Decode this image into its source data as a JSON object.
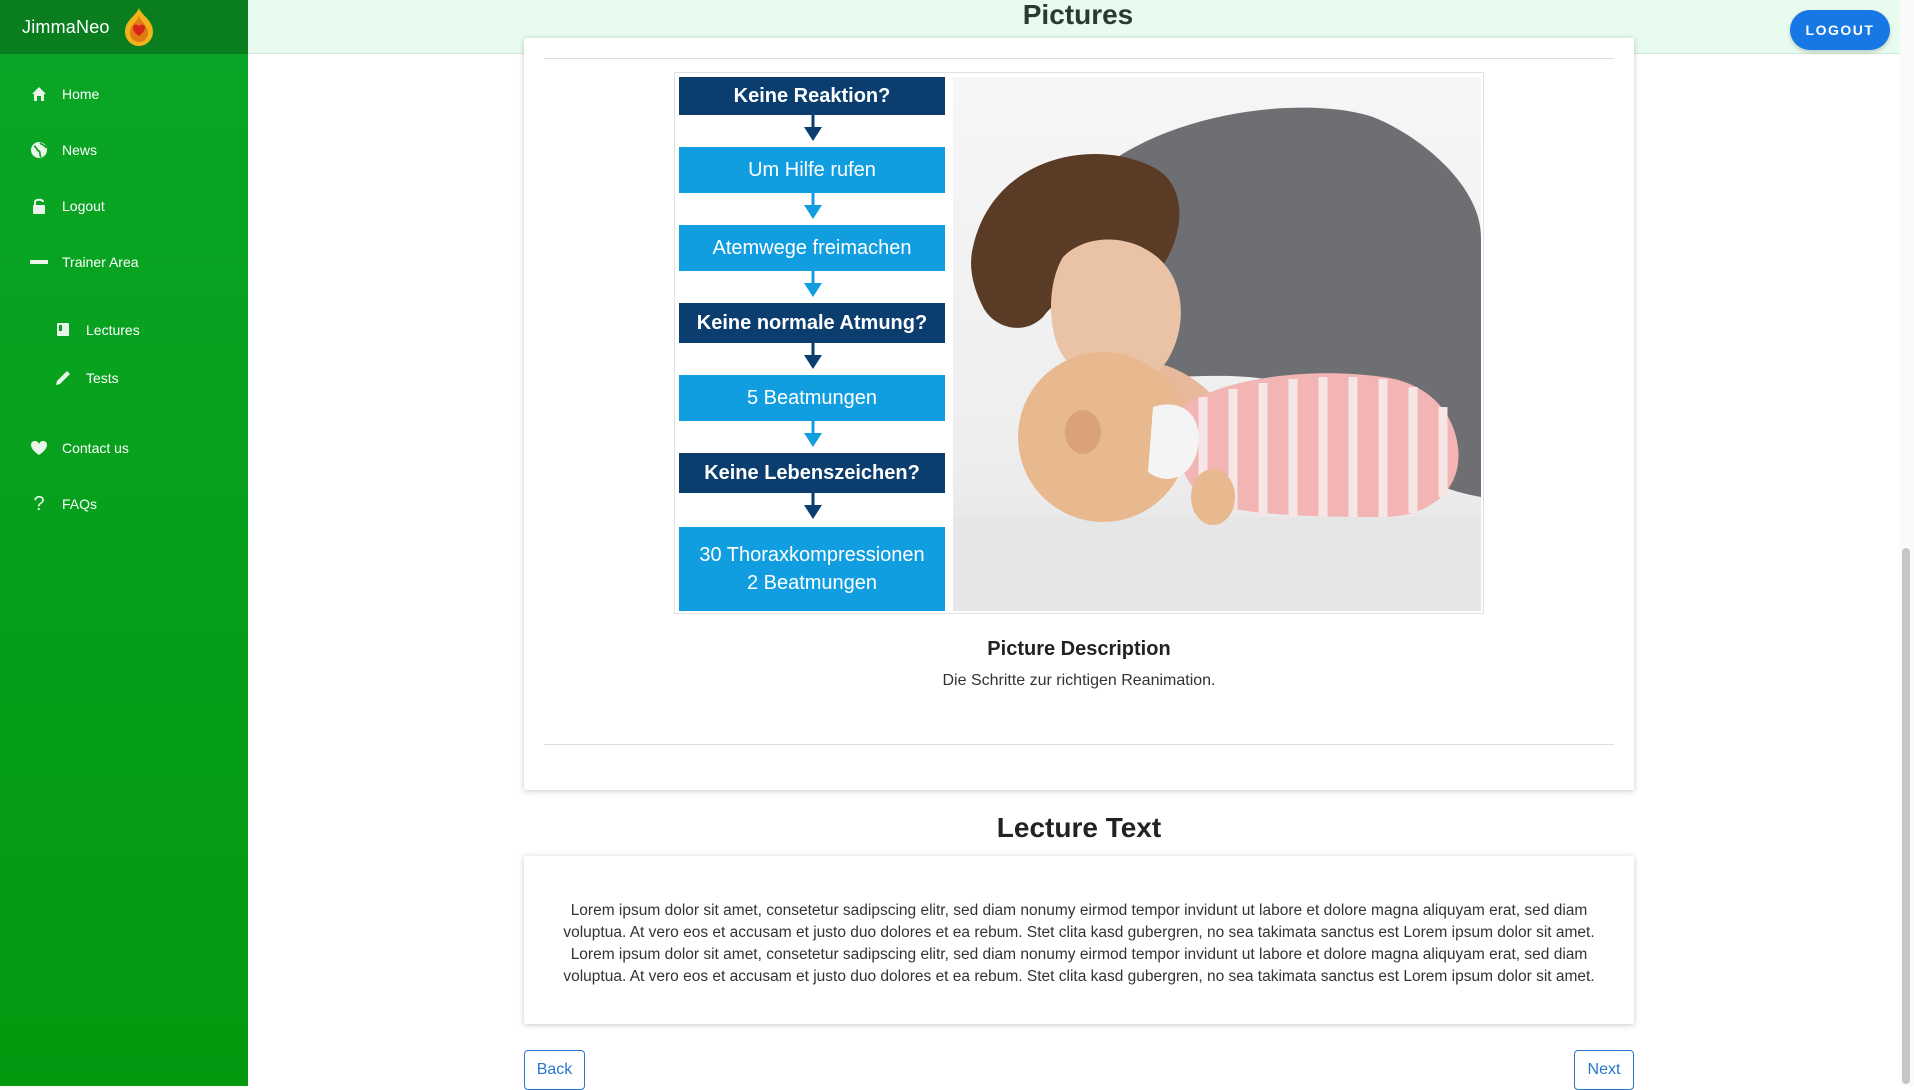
{
  "brand": {
    "name": "JimmaNeo"
  },
  "sidebar": {
    "items": [
      {
        "label": "Home",
        "icon": "home-icon"
      },
      {
        "label": "News",
        "icon": "globe-icon"
      },
      {
        "label": "Logout",
        "icon": "lock-icon"
      },
      {
        "label": "Trainer Area",
        "icon": "minus-icon"
      },
      {
        "label": "Lectures",
        "icon": "book-icon"
      },
      {
        "label": "Tests",
        "icon": "pencil-icon"
      },
      {
        "label": "Contact us",
        "icon": "heart-icon"
      },
      {
        "label": "FAQs",
        "icon": "question-icon"
      }
    ]
  },
  "header": {
    "title": "Pictures",
    "logout_label": "LOGOUT"
  },
  "figure": {
    "steps": [
      {
        "text": "Keine Reaktion?",
        "style": "dark"
      },
      {
        "text": "Um Hilfe rufen",
        "style": "light"
      },
      {
        "text": "Atemwege freimachen",
        "style": "light"
      },
      {
        "text": "Keine normale Atmung?",
        "style": "dark"
      },
      {
        "text": "5 Beatmungen",
        "style": "light"
      },
      {
        "text": "Keine Lebenszeichen?",
        "style": "dark"
      },
      {
        "text": "30 Thoraxkompressionen\n2 Beatmungen",
        "style": "light"
      }
    ]
  },
  "picture_description": {
    "title": "Picture Description",
    "text": "Die Schritte zur richtigen Reanimation."
  },
  "lecture": {
    "title": "Lecture Text",
    "body": "Lorem ipsum dolor sit amet, consetetur sadipscing elitr, sed diam nonumy eirmod tempor invidunt ut labore et dolore magna aliquyam erat, sed diam voluptua. At vero eos et accusam et justo duo dolores et ea rebum. Stet clita kasd gubergren, no sea takimata sanctus est Lorem ipsum dolor sit amet. Lorem ipsum dolor sit amet, consetetur sadipscing elitr, sed diam nonumy eirmod tempor invidunt ut labore et dolore magna aliquyam erat, sed diam voluptua. At vero eos et accusam et justo duo dolores et ea rebum. Stet clita kasd gubergren, no sea takimata sanctus est Lorem ipsum dolor sit amet."
  },
  "navigation": {
    "back_label": "Back",
    "next_label": "Next"
  },
  "colors": {
    "sidebar": "#07a01a",
    "brand_bar": "#0a7d1f",
    "topbar": "#e8fbef",
    "primary_button": "#1677e5",
    "flow_dark": "#0b3e6e",
    "flow_light": "#119ee0"
  }
}
